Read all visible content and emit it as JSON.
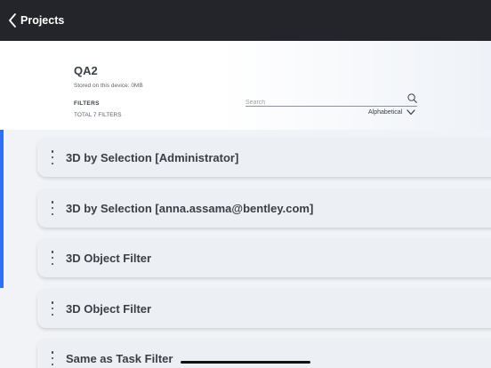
{
  "nav": {
    "back_label": "Projects"
  },
  "project": {
    "name": "QA2",
    "storage": "Stored on this device: 0MB"
  },
  "filters": {
    "title": "FILTERS",
    "total": "TOTAL 7 FILTERS"
  },
  "search": {
    "placeholder": "Search",
    "value": ""
  },
  "sort": {
    "label": "Alphabetical"
  },
  "rows": [
    {
      "label": "3D by Selection [Administrator]"
    },
    {
      "label": "3D by Selection [anna.assama@bentley.com]"
    },
    {
      "label": "3D Object Filter"
    },
    {
      "label": "3D Object Filter"
    },
    {
      "label": "Same as Task Filter"
    }
  ],
  "colors": {
    "topbar": "#23252a",
    "accent": "#2f6ff2",
    "row_bg": "#eceff3",
    "text": "#3a3f46"
  },
  "icons": {
    "back": "chevron-left-icon",
    "search": "search-icon",
    "sort": "chevron-down-icon",
    "row_menu": "more-vertical-icon"
  }
}
